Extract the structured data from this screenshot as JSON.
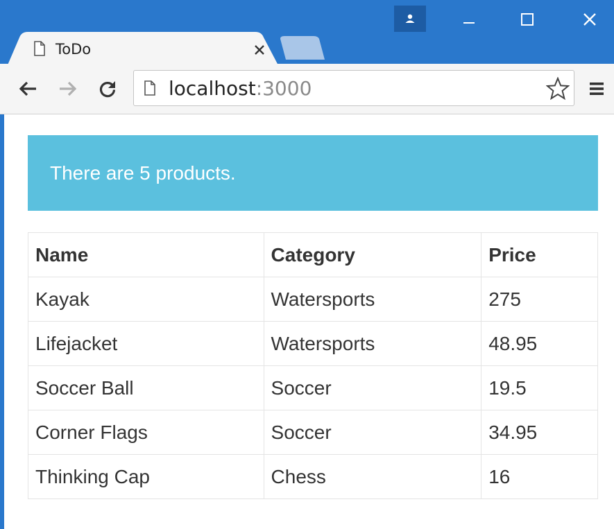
{
  "browser": {
    "tab": {
      "title": "ToDo",
      "favicon": "page-icon",
      "close_icon": "close-icon"
    },
    "window_controls": [
      "profile-icon",
      "minimize-icon",
      "maximize-icon",
      "close-icon"
    ],
    "address_bar": {
      "host": "localhost",
      "port": ":3000"
    },
    "toolbar_icons": [
      "back-arrow-icon",
      "forward-arrow-icon",
      "reload-icon",
      "star-icon",
      "menu-icon"
    ],
    "colors": {
      "frame": "#2a78cc",
      "profile_button": "#1d5ca4",
      "inactive_tab": "#a9c6e8",
      "forward_disabled": "#b0b0b0"
    }
  },
  "page": {
    "alert": {
      "text": "There are 5 products.",
      "color": "#5bc0de"
    },
    "table": {
      "headers": [
        "Name",
        "Category",
        "Price"
      ],
      "rows": [
        [
          "Kayak",
          "Watersports",
          "275"
        ],
        [
          "Lifejacket",
          "Watersports",
          "48.95"
        ],
        [
          "Soccer Ball",
          "Soccer",
          "19.5"
        ],
        [
          "Corner Flags",
          "Soccer",
          "34.95"
        ],
        [
          "Thinking Cap",
          "Chess",
          "16"
        ]
      ]
    }
  }
}
